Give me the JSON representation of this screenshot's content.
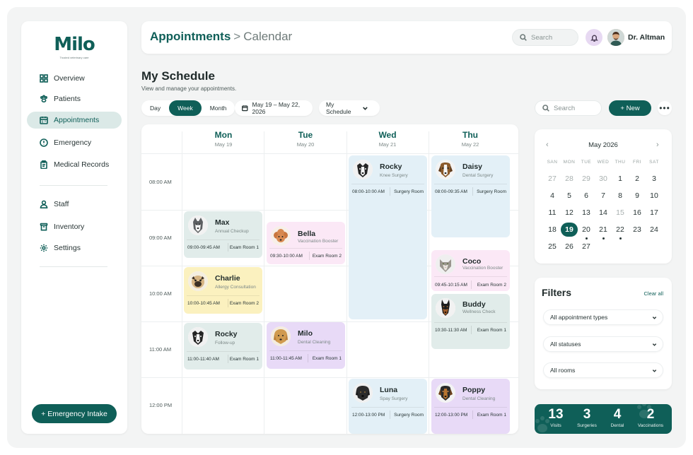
{
  "app": {
    "logo": "Milo",
    "tagline": "Trusted veterinary care"
  },
  "sidebar": {
    "items": [
      {
        "label": "Overview",
        "icon": "grid-icon"
      },
      {
        "label": "Patients",
        "icon": "paw-icon"
      },
      {
        "label": "Appointments",
        "icon": "calendar-icon",
        "active": true
      },
      {
        "label": "Emergency",
        "icon": "alert-icon"
      },
      {
        "label": "Medical Records",
        "icon": "clipboard-icon"
      },
      {
        "label": "Staff",
        "icon": "user-icon"
      },
      {
        "label": "Inventory",
        "icon": "trash-box-icon"
      },
      {
        "label": "Settings",
        "icon": "gear-icon"
      }
    ],
    "intake_button": "+ Emergency Intake"
  },
  "header": {
    "crumb_main": "Appointments",
    "crumb_sep": ">",
    "crumb_sub": "Calendar",
    "search_placeholder": "Search",
    "user_name": "Dr. Altman"
  },
  "schedule": {
    "title": "My Schedule",
    "subtitle": "View and manage your appointments.",
    "views": [
      "Day",
      "Week",
      "Month"
    ],
    "active_view": "Week",
    "date_range": "May 19 – May 22, 2026",
    "schedule_select": "My Schedule",
    "search_placeholder": "Search",
    "new_button": "+ New",
    "more": "•••"
  },
  "days": [
    {
      "name": "Mon",
      "date": "May 19"
    },
    {
      "name": "Tue",
      "date": "May 20"
    },
    {
      "name": "Wed",
      "date": "May 21"
    },
    {
      "name": "Thu",
      "date": "May 22"
    }
  ],
  "times": [
    "08:00 AM",
    "09:00 AM",
    "10:00 AM",
    "11:00 AM",
    "12:00 PM"
  ],
  "appointments": [
    {
      "name": "Max",
      "type": "Annual Checkup",
      "time": "09:00-09:45 AM",
      "room": "Exam Room 1",
      "pet": "husky"
    },
    {
      "name": "Charlie",
      "type": "Allergy Consultation",
      "time": "10:00-10:45 AM",
      "room": "Exam Room 2",
      "pet": "pug"
    },
    {
      "name": "Rocky",
      "type": "Follow-up",
      "time": "11:00-11:40 AM",
      "room": "Exam Room 1",
      "pet": "border-collie"
    },
    {
      "name": "Bella",
      "type": "Vaccination Booster",
      "time": "09:30-10:00 AM",
      "room": "Exam Room 2",
      "pet": "poodle"
    },
    {
      "name": "Milo",
      "type": "Dental Cleaning",
      "time": "11:00-11:45 AM",
      "room": "Exam Room 1",
      "pet": "golden"
    },
    {
      "name": "Rocky",
      "type": "Knee Surgery",
      "time": "08:00-10:00 AM",
      "room": "Surgery Room",
      "pet": "border-collie"
    },
    {
      "name": "Luna",
      "type": "Spay Surgery",
      "time": "12:00-13:00 PM",
      "room": "Surgery Room",
      "pet": "labrador"
    },
    {
      "name": "Daisy",
      "type": "Dental Surgery",
      "time": "08:00-09:35 AM",
      "room": "Surgery Room",
      "pet": "beagle"
    },
    {
      "name": "Coco",
      "type": "Vaccination Booster",
      "time": "09:45-10:15 AM",
      "room": "Exam Room 2",
      "pet": "cat"
    },
    {
      "name": "Buddy",
      "type": "Wellness Check",
      "time": "10:30-11:30 AM",
      "room": "Exam Room 1",
      "pet": "doberman"
    },
    {
      "name": "Poppy",
      "type": "Dental Cleaning",
      "time": "12:00-13:00 PM",
      "room": "Exam Room 1",
      "pet": "beagle"
    }
  ],
  "minical": {
    "month": "May 2026",
    "dow": [
      "SAN",
      "MON",
      "TUE",
      "WED",
      "THU",
      "FRI",
      "SAT"
    ],
    "days": [
      "27",
      "28",
      "29",
      "30",
      "1",
      "2",
      "3",
      "4",
      "5",
      "6",
      "7",
      "8",
      "9",
      "10",
      "11",
      "12",
      "13",
      "14",
      "15",
      "16",
      "17",
      "18",
      "19",
      "20",
      "21",
      "22",
      "23",
      "24",
      "25",
      "26",
      "27"
    ],
    "selected": "19"
  },
  "filters": {
    "title": "Filters",
    "clear": "Clear all",
    "selects": [
      "All appointment types",
      "All statuses",
      "All rooms"
    ]
  },
  "stats": [
    {
      "value": "13",
      "label": "Visits"
    },
    {
      "value": "3",
      "label": "Surgeries"
    },
    {
      "value": "4",
      "label": "Dental"
    },
    {
      "value": "2",
      "label": "Vaccinations"
    }
  ],
  "colors": {
    "brand": "#0f5f58",
    "appt_teal": "#e1ecea",
    "appt_yellow": "#fbf1bf",
    "appt_pink": "#fbe8f6",
    "appt_purple": "#e8daf7",
    "appt_blue": "#e3f0f7",
    "bell_bg": "#e7d9f2"
  }
}
